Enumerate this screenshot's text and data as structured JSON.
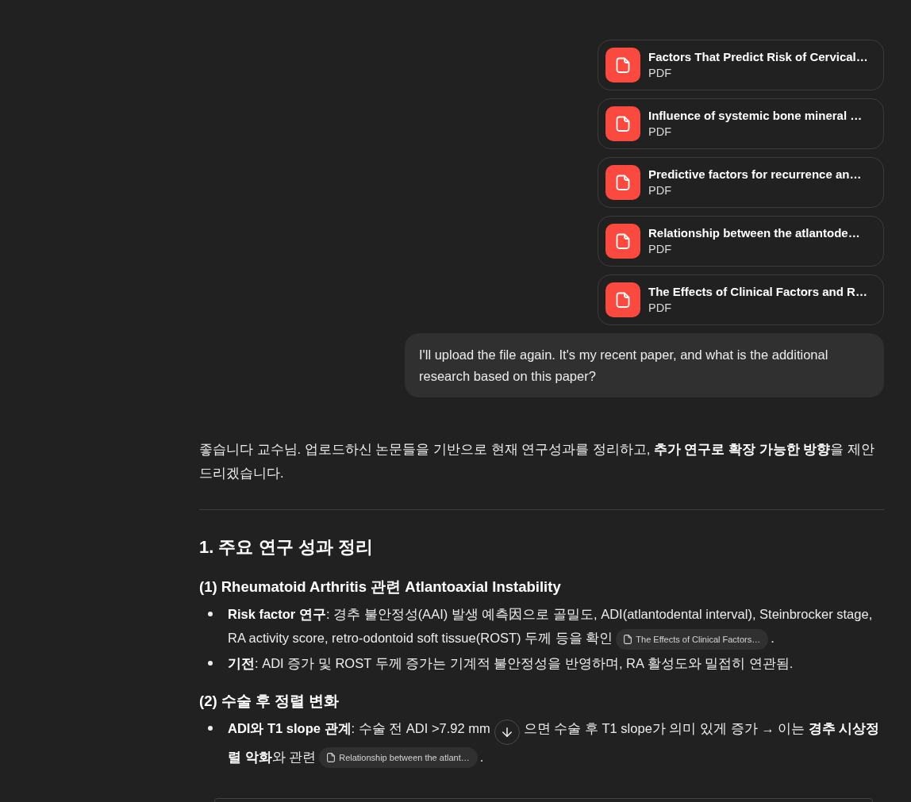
{
  "attachments": [
    {
      "title": "Factors That Predict Risk of Cervical…",
      "type": "PDF"
    },
    {
      "title": "Influence of systemic bone mineral …",
      "type": "PDF"
    },
    {
      "title": "Predictive factors for recurrence an…",
      "type": "PDF"
    },
    {
      "title": "Relationship between the atlantode…",
      "type": "PDF"
    },
    {
      "title": "The Effects of Clinical Factors and R…",
      "type": "PDF"
    }
  ],
  "user_message": {
    "text": "I'll upload the file again. It's my recent paper, and what is the additional research based on this paper?"
  },
  "response": {
    "intro": "좋습니다 교수님. 업로드하신 논문들을 기반으로 현재 연구성과를 정리하고, **추가 연구로 확장 가능한 방향**을 제안드리겠습니다.",
    "section": {
      "heading": "1. 주요 연구 성과 정리",
      "subsections": [
        {
          "heading": "(1) Rheumatoid Arthritis 관련 Atlantoaxial Instability",
          "bullets": [
            {
              "segments": [
                {
                  "kind": "text",
                  "text": "**Risk factor 연구**: 경추 불안정성(AAI) 발생 예측因으로 골밀도, ADI(atlantodental interval), Steinbrocker stage, RA activity score, retro-odontoid soft tissue(ROST) 두께 등을 확인"
                },
                {
                  "kind": "citation",
                  "text": "The Effects of Clinical Factors…"
                },
                {
                  "kind": "text",
                  "text": "."
                }
              ]
            },
            {
              "segments": [
                {
                  "kind": "text",
                  "text": "**기전**: ADI 증가 및 ROST 두께 증가는 기계적 불안정성을 반영하며, RA 활성도와 밀접히 연관됨."
                }
              ]
            }
          ]
        },
        {
          "heading": "(2) 수술 후 정렬 변화",
          "bullets": [
            {
              "segments": [
                {
                  "kind": "text",
                  "text": "**ADI와 T1 slope 관계**: 수술 전 ADI >7.92 mm"
                },
                {
                  "kind": "scroll_button"
                },
                {
                  "kind": "text",
                  "text": "으면 수술 후 T1 slope가 의미 있게 증가 → 이는 **경추 시상정렬 악화**와 관련"
                },
                {
                  "kind": "citation",
                  "text": "Relationship between the atlant…"
                },
                {
                  "kind": "text",
                  "text": "."
                }
              ]
            }
          ]
        }
      ]
    }
  }
}
